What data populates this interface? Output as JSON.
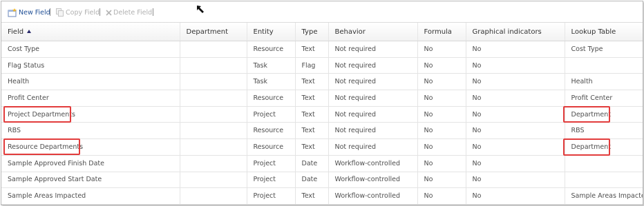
{
  "toolbar": {
    "new_field": "New Field",
    "copy_field": "Copy Field",
    "delete_field": "Delete Field"
  },
  "columns": [
    "Field",
    "Department",
    "Entity",
    "Type",
    "Behavior",
    "Formula",
    "Graphical indicators",
    "Lookup Table"
  ],
  "rows": [
    [
      "Cost Type",
      "",
      "Resource",
      "Text",
      "Not required",
      "No",
      "No",
      "Cost Type"
    ],
    [
      "Flag Status",
      "",
      "Task",
      "Flag",
      "Not required",
      "No",
      "No",
      ""
    ],
    [
      "Health",
      "",
      "Task",
      "Text",
      "Not required",
      "No",
      "No",
      "Health"
    ],
    [
      "Profit Center",
      "",
      "Resource",
      "Text",
      "Not required",
      "No",
      "No",
      "Profit Center"
    ],
    [
      "Project Departments",
      "",
      "Project",
      "Text",
      "Not required",
      "No",
      "No",
      "Department"
    ],
    [
      "RBS",
      "",
      "Resource",
      "Text",
      "Not required",
      "No",
      "No",
      "RBS"
    ],
    [
      "Resource Departments",
      "",
      "Resource",
      "Text",
      "Not required",
      "No",
      "No",
      "Department"
    ],
    [
      "Sample Approved Finish Date",
      "",
      "Project",
      "Date",
      "Workflow-controlled",
      "No",
      "No",
      ""
    ],
    [
      "Sample Approved Start Date",
      "",
      "Project",
      "Date",
      "Workflow-controlled",
      "No",
      "No",
      ""
    ],
    [
      "Sample Areas Impacted",
      "",
      "Project",
      "Text",
      "Workflow-controlled",
      "No",
      "No",
      "Sample Areas Impacted"
    ]
  ],
  "sort": {
    "column": "Field",
    "direction": "ascending"
  },
  "highlight_color": "#e23b3b"
}
